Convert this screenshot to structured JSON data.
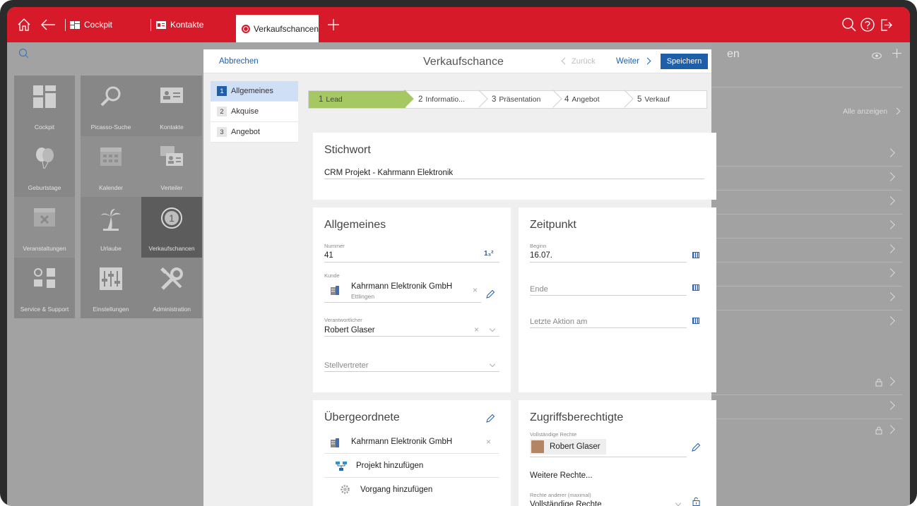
{
  "topbar": {
    "tabs": [
      {
        "label": "Cockpit"
      },
      {
        "label": "Kontakte"
      },
      {
        "label": "Verkaufschancen"
      }
    ]
  },
  "tiles": [
    {
      "label": "Cockpit"
    },
    {
      "label": "Picasso-Suche"
    },
    {
      "label": "Kontakte"
    },
    {
      "label": "Geburtstage"
    },
    {
      "label": "Kalender"
    },
    {
      "label": "Verteiler"
    },
    {
      "label": "Veranstaltungen"
    },
    {
      "label": "Urlaube"
    },
    {
      "label": "Verkaufschancen"
    },
    {
      "label": "Service & Support"
    },
    {
      "label": "Einstellungen"
    },
    {
      "label": "Administration"
    }
  ],
  "background_right": {
    "heading_fragment": "en",
    "alle_anzeigen": "Alle anzeigen"
  },
  "modal": {
    "cancel": "Abbrechen",
    "title": "Verkaufschance",
    "back": "Zurück",
    "next": "Weiter",
    "save": "Speichern"
  },
  "side_nav": [
    {
      "num": "1",
      "label": "Allgemeines"
    },
    {
      "num": "2",
      "label": "Akquise"
    },
    {
      "num": "3",
      "label": "Angebot"
    }
  ],
  "steps": [
    {
      "num": "1",
      "label": "Lead"
    },
    {
      "num": "2",
      "label": "Informatio..."
    },
    {
      "num": "3",
      "label": "Präsentation"
    },
    {
      "num": "4",
      "label": "Angebot"
    },
    {
      "num": "5",
      "label": "Verkauf"
    }
  ],
  "stichwort": {
    "title": "Stichwort",
    "value": "CRM Projekt - Kahrmann Elektronik"
  },
  "allgemeines": {
    "title": "Allgemeines",
    "nummer_label": "Nummer",
    "nummer_value": "41",
    "counter_icon_text": "1₃²",
    "kunde_label": "Kunde",
    "kunde_name": "Kahrmann Elektronik GmbH",
    "kunde_city": "Ettlingen",
    "verantwortlicher_label": "Verantwortlicher",
    "verantwortlicher_value": "Robert Glaser",
    "stellvertreter_placeholder": "Stellvertreter"
  },
  "zeitpunkt": {
    "title": "Zeitpunkt",
    "beginn_label": "Beginn",
    "beginn_value": "16.07.",
    "ende_placeholder": "Ende",
    "letzte_aktion_placeholder": "Letzte Aktion am"
  },
  "uebergeordnete": {
    "title": "Übergeordnete",
    "item": "Kahrmann Elektronik GmbH",
    "add_projekt": "Projekt hinzufügen",
    "add_vorgang": "Vorgang hinzufügen"
  },
  "zugriff": {
    "title": "Zugriffsberechtigte",
    "full_rights_label": "Vollständige Rechte",
    "person": "Robert Glaser",
    "weitere": "Weitere Rechte...",
    "rechte_anderer_label": "Rechte anderer (maximal)",
    "rechte_anderer_value": "Vollständige Rechte"
  },
  "colors": {
    "brand_red": "#d61a2a",
    "accent_blue": "#1f5faa",
    "lead_green": "#a6c863"
  }
}
